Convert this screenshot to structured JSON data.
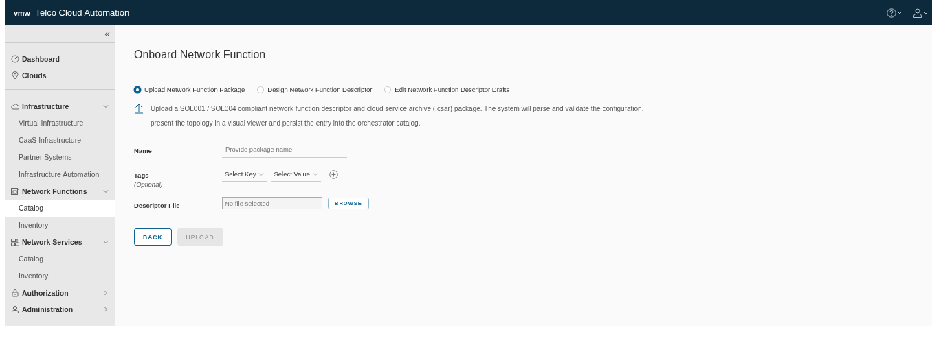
{
  "header": {
    "logo": "vmw",
    "title": "Telco Cloud Automation"
  },
  "sidebar": {
    "collapse": "«",
    "sections": [
      {
        "items": [
          {
            "label": "Dashboard"
          },
          {
            "label": "Clouds"
          }
        ]
      },
      {
        "items": [
          {
            "label": "Infrastructure",
            "expanded": true,
            "children": [
              {
                "label": "Virtual Infrastructure",
                "selected": false
              },
              {
                "label": "CaaS Infrastructure",
                "selected": false
              },
              {
                "label": "Partner Systems",
                "selected": false
              },
              {
                "label": "Infrastructure Automation",
                "selected": false
              }
            ]
          },
          {
            "label": "Network Functions",
            "expanded": true,
            "children": [
              {
                "label": "Catalog",
                "selected": true
              },
              {
                "label": "Inventory",
                "selected": false
              }
            ]
          },
          {
            "label": "Network Services",
            "expanded": true,
            "children": [
              {
                "label": "Catalog",
                "selected": false
              },
              {
                "label": "Inventory",
                "selected": false
              }
            ]
          },
          {
            "label": "Authorization",
            "expanded": false
          },
          {
            "label": "Administration",
            "expanded": false
          }
        ]
      }
    ]
  },
  "main": {
    "title": "Onboard Network Function",
    "options": [
      {
        "label": "Upload Network Function Package",
        "selected": true
      },
      {
        "label": "Design Network Function Descriptor",
        "selected": false
      },
      {
        "label": "Edit Network Function Descriptor Drafts",
        "selected": false
      }
    ],
    "description": "Upload a SOL001 / SOL004 compliant network function descriptor and cloud service archive (.csar) package. The system will parse and validate the configuration, present the topology in a visual viewer and persist the entry into the orchestrator catalog.",
    "form": [
      {
        "kind": "text",
        "label": "Name",
        "placeholder": "Provide package name"
      },
      {
        "kind": "tags",
        "label": "Tags",
        "hint": "(Optional)",
        "selects": [
          "Select Key",
          "Select Value"
        ]
      },
      {
        "kind": "file",
        "label": "Descriptor File",
        "placeholder": "No file selected",
        "button": "BROWSE"
      }
    ],
    "buttons": [
      {
        "label": "BACK",
        "disabled": false
      },
      {
        "label": "UPLOAD",
        "disabled": true
      }
    ]
  }
}
